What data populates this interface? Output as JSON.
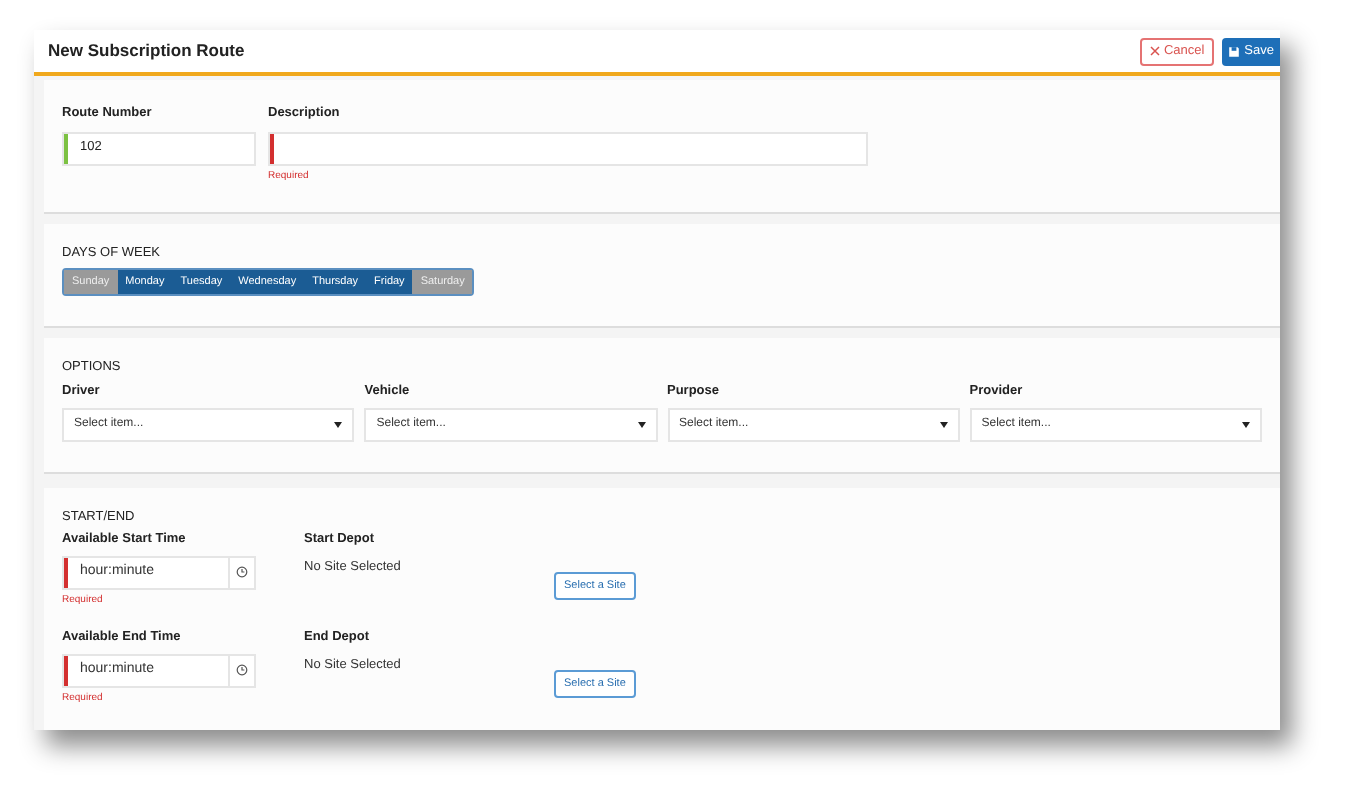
{
  "window": {
    "title": "New Subscription Route"
  },
  "header_buttons": [
    {
      "kind": "cancel",
      "label": "Cancel"
    },
    {
      "kind": "save",
      "label": "Save"
    }
  ],
  "route": {
    "fields": [
      {
        "label": "Route Number",
        "value": "102",
        "valid": true
      },
      {
        "label": "Description",
        "valid": false,
        "error": "Required"
      }
    ]
  },
  "days_of_week": {
    "heading": "DAYS OF WEEK",
    "days": [
      {
        "label": "Sunday",
        "selected": false
      },
      {
        "label": "Monday",
        "selected": true
      },
      {
        "label": "Tuesday",
        "selected": true
      },
      {
        "label": "Wednesday",
        "selected": true
      },
      {
        "label": "Thursday",
        "selected": true
      },
      {
        "label": "Friday",
        "selected": true
      },
      {
        "label": "Saturday",
        "selected": false
      }
    ]
  },
  "options": {
    "heading": "OPTIONS",
    "selects": [
      {
        "label": "Driver",
        "placeholder": "Select item..."
      },
      {
        "label": "Vehicle",
        "placeholder": "Select item..."
      },
      {
        "label": "Purpose",
        "placeholder": "Select item..."
      },
      {
        "label": "Provider",
        "placeholder": "Select item..."
      }
    ]
  },
  "start_end": {
    "heading": "START/END",
    "rows": [
      {
        "time_label": "Available Start Time",
        "time_placeholder": "hour:minute",
        "time_valid": false,
        "error": "Required",
        "depot_label": "Start Depot",
        "depot_value": "No Site Selected",
        "button": "Select a Site"
      },
      {
        "time_label": "Available End Time",
        "time_placeholder": "hour:minute",
        "time_valid": false,
        "error": "Required",
        "depot_label": "End Depot",
        "depot_value": "No Site Selected",
        "button": "Select a Site"
      }
    ]
  }
}
